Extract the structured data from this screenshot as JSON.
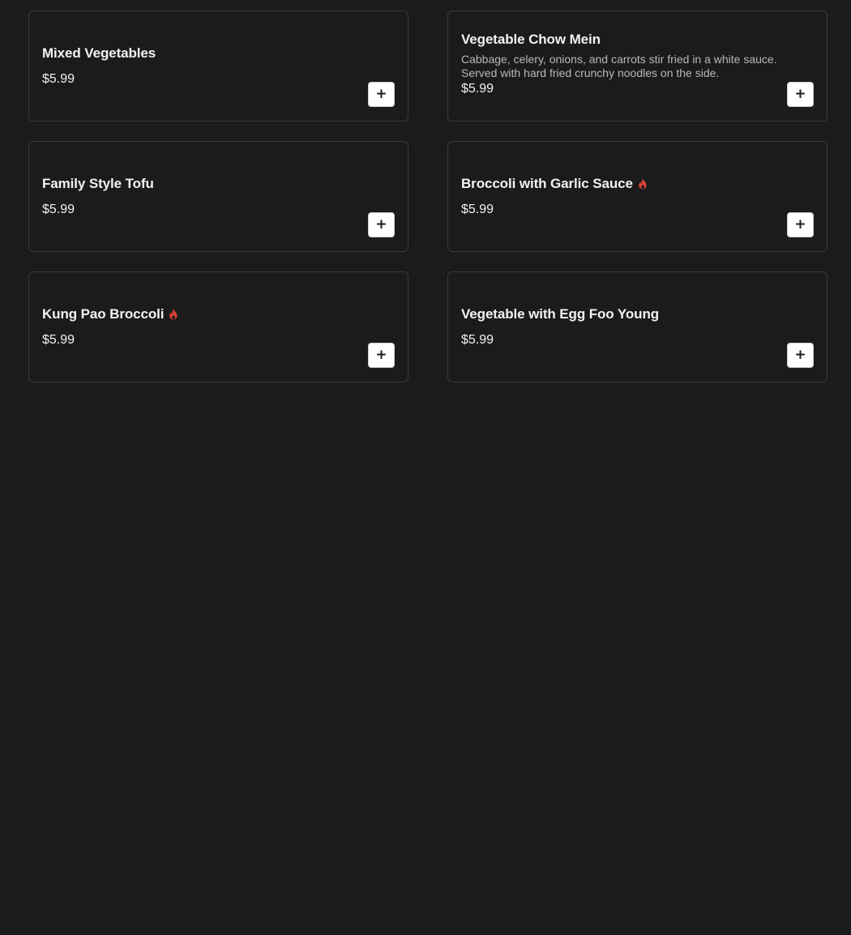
{
  "colors": {
    "background": "#1b1b1b",
    "card_border": "#3a3a3a",
    "spicy": "#e0423a",
    "button_bg": "#ffffff"
  },
  "menu_items": [
    {
      "name": "Mixed Vegetables",
      "description": "",
      "price": "$5.99",
      "spicy": false,
      "add_icon": "plus-icon"
    },
    {
      "name": "Vegetable Chow Mein",
      "description": "Cabbage, celery, onions, and carrots stir fried in a white sauce. Served with hard fried crunchy noodles on the side.",
      "price": "$5.99",
      "spicy": false,
      "add_icon": "plus-icon"
    },
    {
      "name": "Family Style Tofu",
      "description": "",
      "price": "$5.99",
      "spicy": false,
      "add_icon": "plus-icon"
    },
    {
      "name": "Broccoli with Garlic Sauce",
      "description": "",
      "price": "$5.99",
      "spicy": true,
      "spicy_icon": "flame-icon",
      "add_icon": "plus-icon"
    },
    {
      "name": "Kung Pao Broccoli",
      "description": "",
      "price": "$5.99",
      "spicy": true,
      "spicy_icon": "flame-icon",
      "add_icon": "plus-icon"
    },
    {
      "name": "Vegetable with Egg Foo Young",
      "description": "",
      "price": "$5.99",
      "spicy": false,
      "add_icon": "plus-icon"
    }
  ],
  "plus_glyph": "+"
}
